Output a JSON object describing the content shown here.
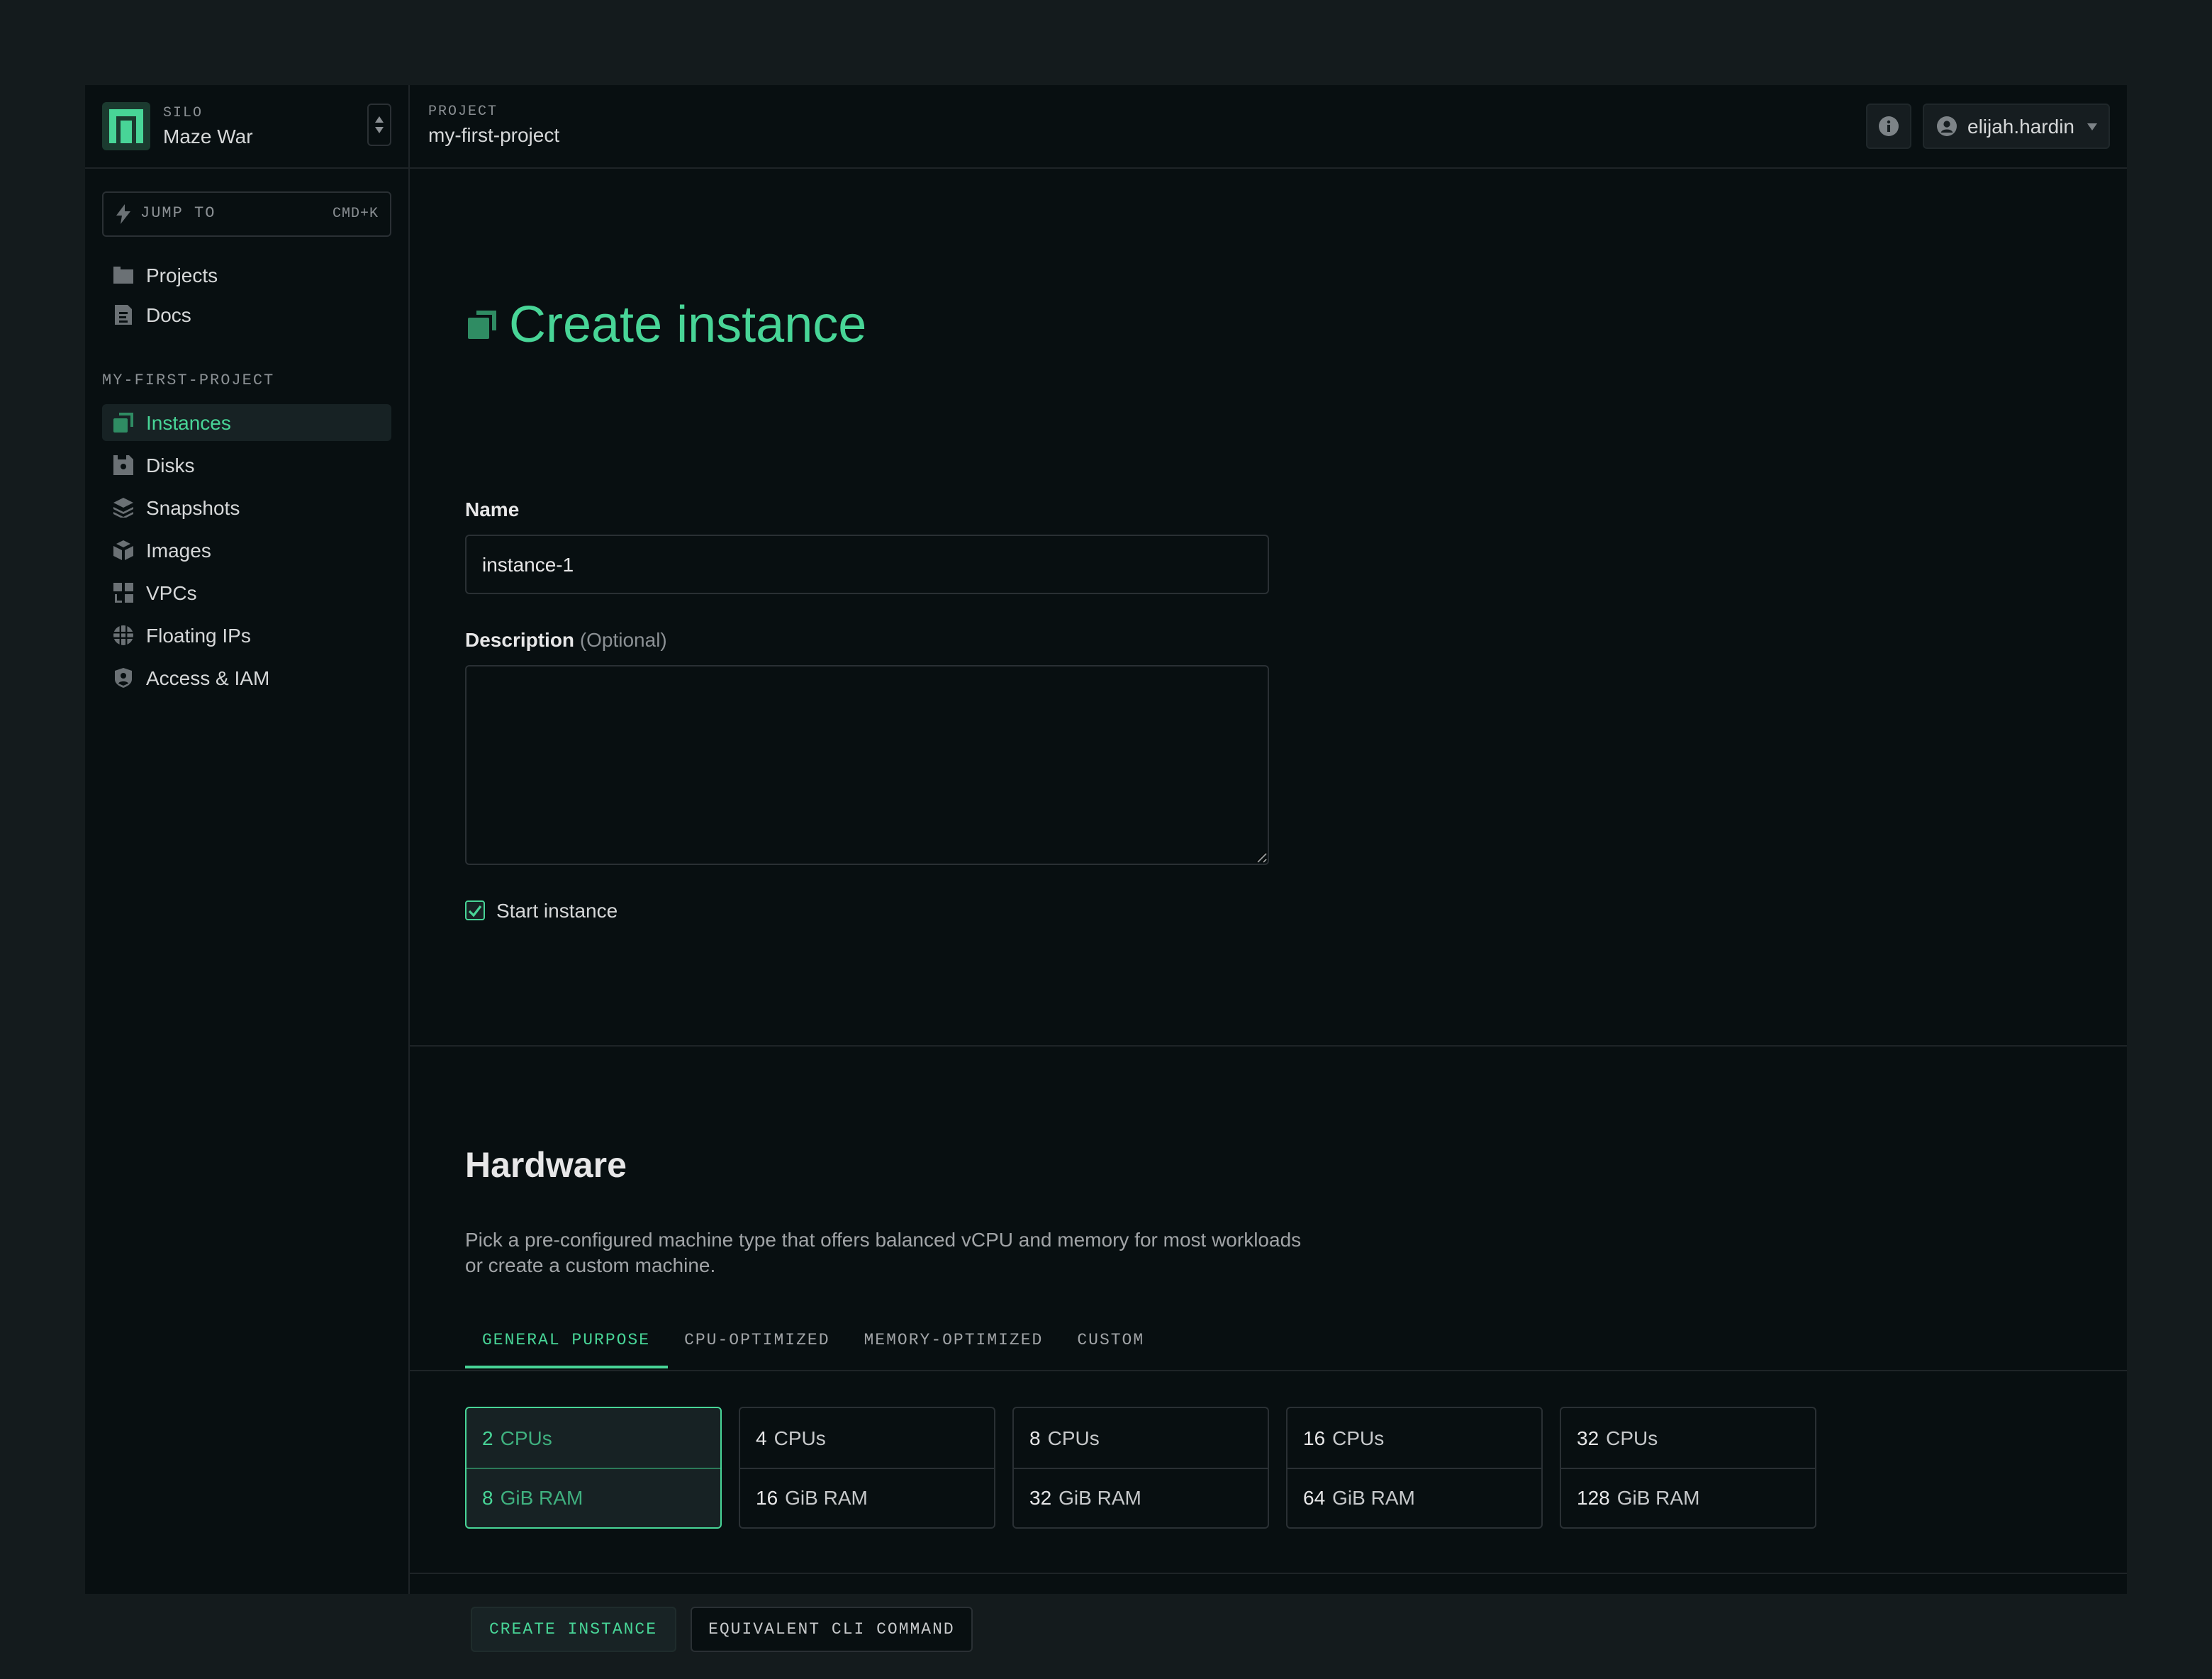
{
  "silo": {
    "label": "SILO",
    "name": "Maze War"
  },
  "jump_to": {
    "label": "JUMP TO",
    "shortcut": "CMD+K"
  },
  "sidebar": {
    "global_items": [
      {
        "label": "Projects",
        "icon": "folder-icon"
      },
      {
        "label": "Docs",
        "icon": "document-icon"
      }
    ],
    "project_section_label": "MY-FIRST-PROJECT",
    "project_items": [
      {
        "label": "Instances",
        "icon": "instances-icon",
        "active": true
      },
      {
        "label": "Disks",
        "icon": "disk-icon"
      },
      {
        "label": "Snapshots",
        "icon": "layers-icon"
      },
      {
        "label": "Images",
        "icon": "cube-icon"
      },
      {
        "label": "VPCs",
        "icon": "grid-icon"
      },
      {
        "label": "Floating IPs",
        "icon": "globe-icon"
      },
      {
        "label": "Access & IAM",
        "icon": "shield-user-icon"
      }
    ]
  },
  "topbar": {
    "breadcrumb_label": "PROJECT",
    "breadcrumb_value": "my-first-project",
    "user_name": "elijah.hardin"
  },
  "page": {
    "title": "Create instance",
    "name_label": "Name",
    "name_value": "instance-1",
    "description_label": "Description",
    "description_optional": "(Optional)",
    "description_value": "",
    "start_instance_label": "Start instance",
    "start_instance_checked": true
  },
  "hardware": {
    "title": "Hardware",
    "description": "Pick a pre-configured machine type that offers balanced vCPU and memory for most workloads or create a custom machine.",
    "tabs": [
      {
        "label": "GENERAL PURPOSE",
        "active": true
      },
      {
        "label": "CPU-OPTIMIZED"
      },
      {
        "label": "MEMORY-OPTIMIZED"
      },
      {
        "label": "CUSTOM"
      }
    ],
    "presets": [
      {
        "cpus": "2",
        "cpu_unit": "CPUs",
        "ram": "8",
        "ram_unit": "GiB RAM",
        "selected": true
      },
      {
        "cpus": "4",
        "cpu_unit": "CPUs",
        "ram": "16",
        "ram_unit": "GiB RAM"
      },
      {
        "cpus": "8",
        "cpu_unit": "CPUs",
        "ram": "32",
        "ram_unit": "GiB RAM"
      },
      {
        "cpus": "16",
        "cpu_unit": "CPUs",
        "ram": "64",
        "ram_unit": "GiB RAM"
      },
      {
        "cpus": "32",
        "cpu_unit": "CPUs",
        "ram": "128",
        "ram_unit": "GiB RAM"
      }
    ]
  },
  "footer": {
    "create_label": "CREATE INSTANCE",
    "cli_label": "EQUIVALENT CLI COMMAND"
  },
  "colors": {
    "accent": "#48d597",
    "background": "#080f11",
    "page_background": "#141b1d"
  }
}
